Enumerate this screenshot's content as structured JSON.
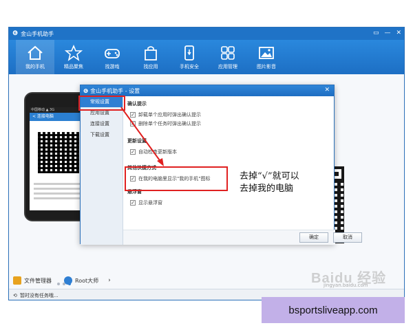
{
  "app": {
    "title": "金山手机助手"
  },
  "window_buttons": [
    "▭",
    "—",
    "✕"
  ],
  "toolbar": [
    {
      "label": "我的手机",
      "icon": "home-icon"
    },
    {
      "label": "精品聚焦",
      "icon": "star-icon"
    },
    {
      "label": "找游戏",
      "icon": "gamepad-icon"
    },
    {
      "label": "找应用",
      "icon": "bag-icon"
    },
    {
      "label": "手机安全",
      "icon": "shield-phone-icon"
    },
    {
      "label": "应用管理",
      "icon": "grid-icon"
    },
    {
      "label": "图片影音",
      "icon": "picture-icon"
    }
  ],
  "phone": {
    "status_text": "中国移动 ▲ 3G",
    "header": "< 连接电脑"
  },
  "bottom_tools": [
    {
      "label": "文件管理器",
      "icon": "folder-icon"
    },
    {
      "label": "Root大师",
      "icon": "root-icon"
    }
  ],
  "statusbar": {
    "text": "暂时没有任务哦..."
  },
  "dialog": {
    "title": "金山手机助手 - 设置",
    "nav": [
      "常规设置",
      "应用设置",
      "连接设置",
      "下载设置"
    ],
    "sections": [
      {
        "header": "确认提示",
        "options": [
          "卸载单个应用时弹出确认提示",
          "删除单个任务时弹出确认提示"
        ]
      },
      {
        "header": "更新设置",
        "options": [
          "自动检查更新版本"
        ]
      },
      {
        "header": "其他快捷方式",
        "options": [
          "在我的电脑里显示\"我的手机\"图标"
        ]
      },
      {
        "header": "悬浮窗",
        "options": [
          "显示悬浮窗"
        ]
      }
    ],
    "ok_label": "确定",
    "cancel_label": "取消"
  },
  "annotation": {
    "line1": "去掉“√”就可以",
    "line2": "去掉我的电脑"
  },
  "watermark": {
    "main": "Baidu 经验",
    "sub": "jingyan.baidu.com"
  },
  "banner": {
    "text": "bsportsliveapp.com"
  }
}
